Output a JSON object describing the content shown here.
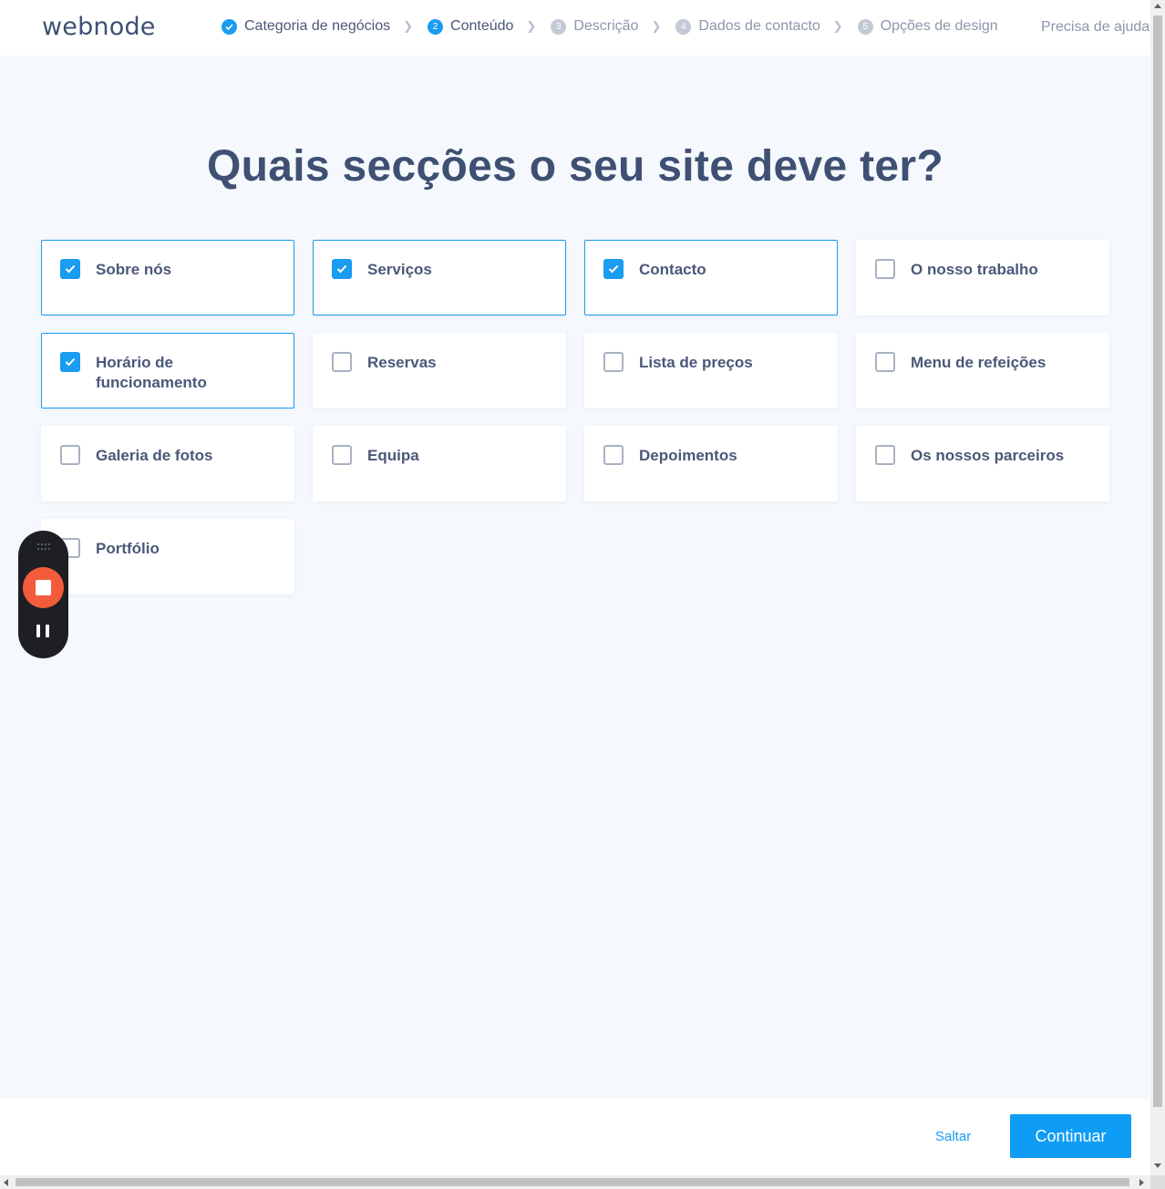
{
  "header": {
    "logo": "webnode",
    "steps": [
      {
        "num": "",
        "label": "Categoria de negócios",
        "state": "done"
      },
      {
        "num": "2",
        "label": "Conteúdo",
        "state": "active"
      },
      {
        "num": "3",
        "label": "Descrição",
        "state": "pending"
      },
      {
        "num": "4",
        "label": "Dados de contacto",
        "state": "pending"
      },
      {
        "num": "5",
        "label": "Opções de design",
        "state": "pending"
      }
    ],
    "help": "Precisa de ajuda"
  },
  "main": {
    "title": "Quais secções o seu site deve ter?",
    "sections": [
      {
        "label": "Sobre nós",
        "checked": true
      },
      {
        "label": "Serviços",
        "checked": true
      },
      {
        "label": "Contacto",
        "checked": true
      },
      {
        "label": "O nosso trabalho",
        "checked": false
      },
      {
        "label": "Horário de funcionamento",
        "checked": true
      },
      {
        "label": "Reservas",
        "checked": false
      },
      {
        "label": "Lista de preços",
        "checked": false
      },
      {
        "label": "Menu de refeições",
        "checked": false
      },
      {
        "label": "Galeria de fotos",
        "checked": false
      },
      {
        "label": "Equipa",
        "checked": false
      },
      {
        "label": "Depoimentos",
        "checked": false
      },
      {
        "label": "Os nossos parceiros",
        "checked": false
      },
      {
        "label": "Portfólio",
        "checked": false
      }
    ]
  },
  "footer": {
    "skip_label": "Saltar",
    "continue_label": "Continuar"
  },
  "colors": {
    "accent": "#1a9cf0",
    "heading": "#3f5073",
    "background": "#f5f9fd",
    "record": "#f25c3b"
  }
}
